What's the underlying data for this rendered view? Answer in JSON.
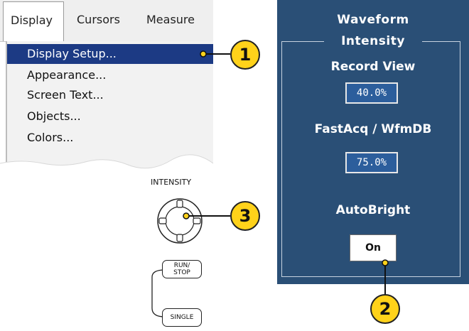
{
  "menubar": {
    "items": [
      {
        "label": "Display"
      },
      {
        "label": "Cursors"
      },
      {
        "label": "Measure"
      }
    ]
  },
  "dropdown": {
    "items": [
      {
        "label": "Display Setup...",
        "selected": true
      },
      {
        "label": "Appearance..."
      },
      {
        "label": "Screen Text..."
      },
      {
        "label": "Objects..."
      },
      {
        "label": "Colors..."
      }
    ]
  },
  "panel": {
    "title_line1": "Waveform",
    "title_line2": "Intensity",
    "record_view_label": "Record View",
    "record_view_value": "40.0%",
    "fastacq_label": "FastAcq / WfmDB",
    "fastacq_value": "75.0%",
    "autobright_label": "AutoBright",
    "autobright_button": "On",
    "bg_color": "#2a4f76"
  },
  "controls": {
    "intensity_label": "INTENSITY",
    "run_stop_line1": "RUN/",
    "run_stop_line2": "STOP",
    "single_label": "SINGLE"
  },
  "callouts": [
    "1",
    "2",
    "3"
  ],
  "colors": {
    "selection": "#1c3a84",
    "callout": "#ffd21a"
  }
}
